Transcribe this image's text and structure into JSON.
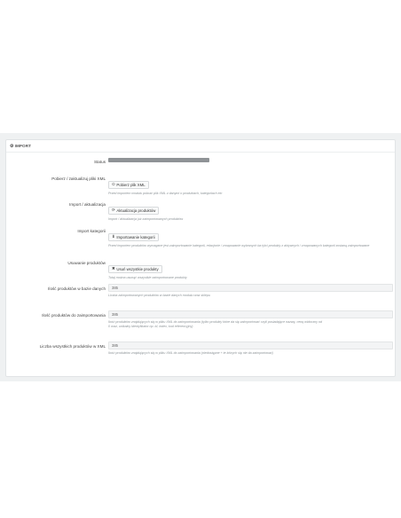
{
  "panel": {
    "title": "IMPORT"
  },
  "status": {
    "label": "Status"
  },
  "download": {
    "label": "Pobierz / zaktualizuj pliki XML",
    "button": "Pobierz plik XML",
    "help": "Przed importem modułu pobrać plik XML z danymi o produktach, kategoriach etc"
  },
  "update": {
    "label": "Import / aktualizacja",
    "button": "Aktualizacja produktów",
    "help": "Import / aktualizacja już zaimportowanych produktów"
  },
  "categories": {
    "label": "Import kategorii",
    "button": "Importowanie kategorii",
    "help": "Przed importem produktów wymagane jest zaimportowanie kategorii, relacjonie / zmapowanie wybranych ba tylci produkty z aktywnych / zmapowanych kategorii zostaną zaimportowane"
  },
  "delete": {
    "label": "Usuwanie produktów",
    "button": "Usuń wszystkie produkty",
    "help": "Tutaj można usunąć wszystkie zaimportowane produkty"
  },
  "db_count": {
    "label": "Ilość produktów w bazie danych",
    "value": "385",
    "help": "Liczba zaimportowanych produktów w bazie danych modułu oraz sklepu"
  },
  "to_import": {
    "label": "Ilość produktów do zaimportowania",
    "value": "385",
    "help_line1": "Ilość produktów znajdujących się w pliku XML do zaimportowania (tylko produkty które da się zaimportować czyli posiadające nazwę, cenę widoczny od",
    "help_line2": "0 oraz, unikalny identyfikator np. id, index, kod referencyjny)"
  },
  "xml_count": {
    "label": "Liczba wszystkich produktów w XML",
    "value": "385",
    "help": "Ilość produktów znajdujących się w pliku XML do zaimportowania (niedostępne + te których się nie da zaimportować)"
  },
  "icons": {
    "heading": "cogs-icon",
    "download": "circle-download-icon",
    "update": "refresh-icon",
    "categories": "arrow-down-icon",
    "delete": "close-icon"
  }
}
